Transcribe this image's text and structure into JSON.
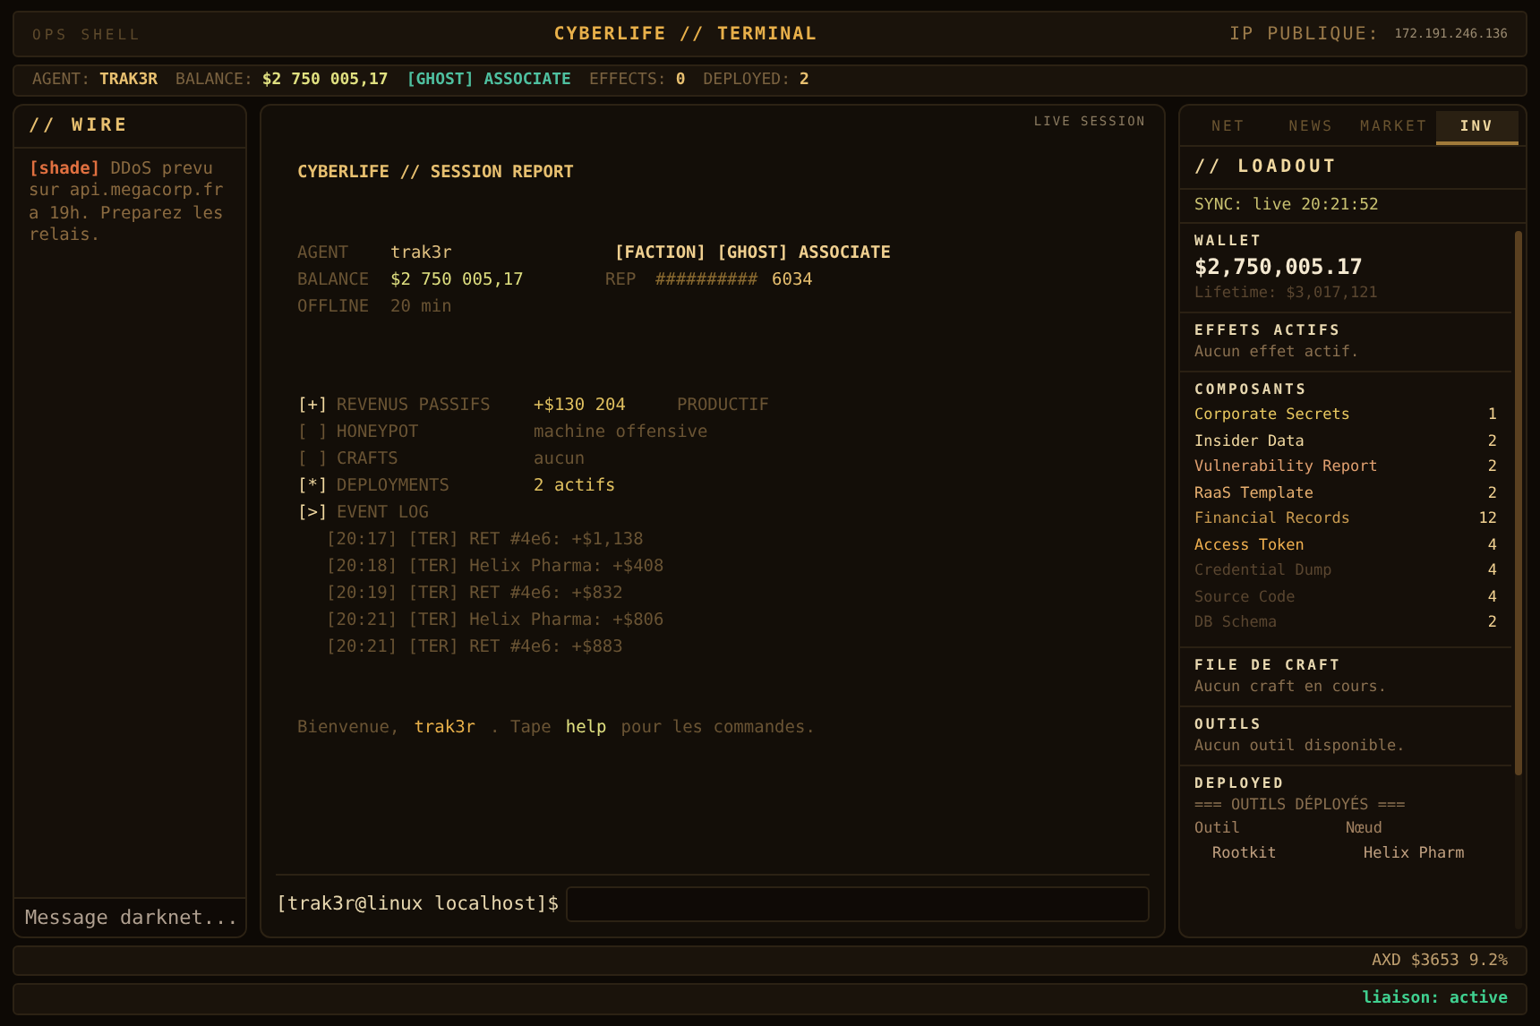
{
  "topbar": {
    "left": "OPS SHELL",
    "title": "CYBERLIFE // TERMINAL",
    "ip_label": "IP PUBLIQUE:",
    "ip": "172.191.246.136"
  },
  "statusline": [
    {
      "label": "AGENT:",
      "value": "TRAK3R",
      "kind": "plain"
    },
    {
      "label": "BALANCE:",
      "value": "$2 750 005,17",
      "kind": "money"
    },
    {
      "value": "[GHOST] ASSOCIATE",
      "kind": "faction"
    },
    {
      "label": "EFFECTS:",
      "value": "0",
      "kind": "plain"
    },
    {
      "label": "DEPLOYED:",
      "value": "2",
      "kind": "plain"
    }
  ],
  "wire": {
    "title": "// WIRE",
    "messages": [
      {
        "author": "[shade]",
        "text": "DDoS prevu sur api.megacorp.fr a 19h. Preparez les relais."
      }
    ],
    "placeholder": "Message darknet..."
  },
  "session": {
    "badge": "LIVE SESSION",
    "title": "CYBERLIFE // SESSION REPORT",
    "agent": {
      "label": "AGENT",
      "value": "trak3r",
      "faction": "[FACTION] [GHOST] ASSOCIATE"
    },
    "balance": {
      "label": "BALANCE",
      "value": "$2 750 005,17",
      "rep_label": "REP",
      "rep_bar": "##########",
      "rep": "6034"
    },
    "offline": {
      "label": "OFFLINE",
      "value": "20 min"
    },
    "sections": [
      {
        "marker": "[+]",
        "label": "REVENUS PASSIFS",
        "value": "+$130 204",
        "note": "PRODUCTIF",
        "active": true
      },
      {
        "marker": "[ ]",
        "label": "HONEYPOT",
        "value": "machine offensive",
        "active": false
      },
      {
        "marker": "[ ]",
        "label": "CRAFTS",
        "value": "aucun",
        "active": false
      },
      {
        "marker": "[*]",
        "label": "DEPLOYMENTS",
        "value": "2 actifs",
        "active": true
      },
      {
        "marker": "[>]",
        "label": "EVENT LOG",
        "active": true
      }
    ],
    "events": [
      "[20:17] [TER] RET #4e6: +$1,138",
      "[20:18] [TER] Helix Pharma: +$408",
      "[20:19] [TER] RET #4e6: +$832",
      "[20:21] [TER] Helix Pharma: +$806",
      "[20:21] [TER] RET #4e6: +$883"
    ],
    "welcome": {
      "pre": "Bienvenue,",
      "user": "trak3r",
      "mid": ". Tape",
      "cmd": "help",
      "post": "pour les commandes."
    },
    "prompt": "[trak3r@linux localhost]$"
  },
  "tabs": [
    {
      "label": "NET",
      "selected": false
    },
    {
      "label": "NEWS",
      "selected": false
    },
    {
      "label": "MARKET",
      "selected": false
    },
    {
      "label": "INV",
      "selected": true
    }
  ],
  "loadout": {
    "title": "// LOADOUT",
    "sync": "SYNC: live 20:21:52",
    "wallet": {
      "title": "WALLET",
      "amount": "$2,750,005.17",
      "lifetime": "Lifetime: $3,017,121"
    },
    "effects": {
      "title": "EFFETS ACTIFS",
      "text": "Aucun effet actif."
    },
    "components": {
      "title": "COMPOSANTS",
      "items": [
        {
          "name": "Corporate Secrets",
          "count": "1",
          "color": "#e8c860"
        },
        {
          "name": "Insider Data",
          "count": "2",
          "color": "#f0d8a0"
        },
        {
          "name": "Vulnerability Report",
          "count": "2",
          "color": "#e0a070"
        },
        {
          "name": "RaaS Template",
          "count": "2",
          "color": "#e8b070"
        },
        {
          "name": "Financial Records",
          "count": "12",
          "color": "#c89a50"
        },
        {
          "name": "Access Token",
          "count": "4",
          "color": "#f0b050"
        },
        {
          "name": "Credential Dump",
          "count": "4",
          "color": "#5a4630"
        },
        {
          "name": "Source Code",
          "count": "4",
          "color": "#5a4630"
        },
        {
          "name": "DB Schema",
          "count": "2",
          "color": "#5a4630"
        }
      ]
    },
    "craft": {
      "title": "FILE DE CRAFT",
      "text": "Aucun craft en cours."
    },
    "tools": {
      "title": "OUTILS",
      "text": "Aucun outil disponible."
    },
    "deployed": {
      "title": "DEPLOYED",
      "header": "=== OUTILS DÉPLOYÉS ===",
      "columns": [
        "Outil",
        "Nœud"
      ],
      "rows": [
        [
          "Rootkit",
          "Helix Pharm"
        ]
      ]
    }
  },
  "ticker": "AXD $3653 9.2%",
  "link": "liaison: active"
}
